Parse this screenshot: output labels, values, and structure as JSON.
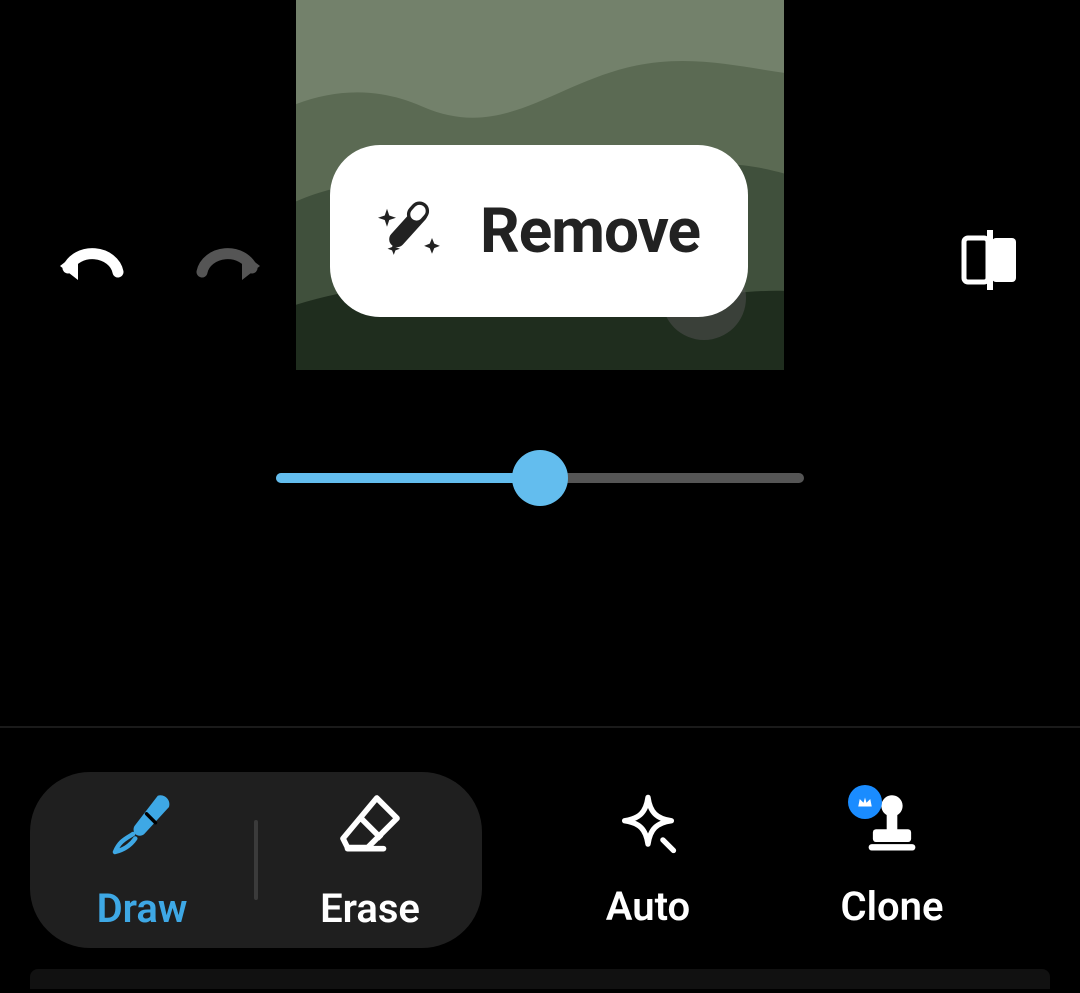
{
  "action_button": {
    "label": "Remove"
  },
  "slider": {
    "value_percent": 50
  },
  "tools": {
    "group": [
      {
        "id": "draw",
        "label": "Draw",
        "active": true
      },
      {
        "id": "erase",
        "label": "Erase",
        "active": false
      }
    ],
    "standalone": [
      {
        "id": "auto",
        "label": "Auto",
        "badge": false
      },
      {
        "id": "clone",
        "label": "Clone",
        "badge": true
      }
    ]
  },
  "colors": {
    "accent": "#63bdee",
    "accent_text": "#3ea8e5",
    "badge": "#1a8cff"
  },
  "history": {
    "undo_enabled": true,
    "redo_enabled": false
  }
}
